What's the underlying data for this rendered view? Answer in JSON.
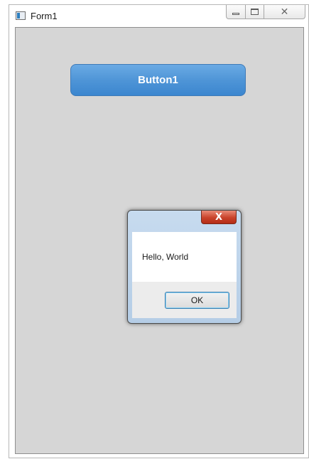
{
  "window": {
    "title": "Form1",
    "buttons": [
      "minimize-icon",
      "maximize-icon",
      "close-icon"
    ]
  },
  "form": {
    "button1_label": "Button1"
  },
  "message_box": {
    "text": "Hello, World",
    "ok_label": "OK",
    "close_glyph": "X"
  },
  "colors": {
    "button_blue": "#4f95d7",
    "client_bg": "#d6d6d6",
    "close_red": "#c9432b"
  }
}
